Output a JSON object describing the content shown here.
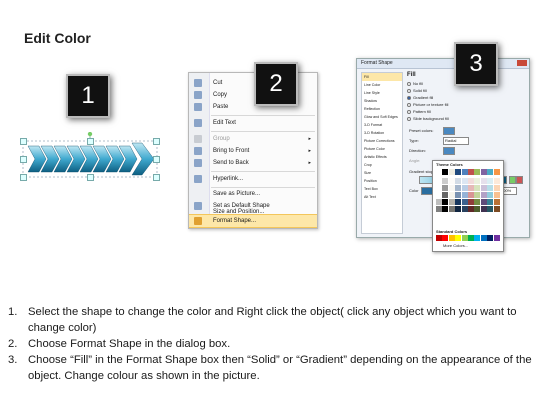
{
  "title": "Edit Color",
  "badges": [
    "1",
    "2",
    "3"
  ],
  "menu": {
    "items": [
      {
        "label": "Cut",
        "arrow": ""
      },
      {
        "label": "Copy",
        "arrow": ""
      },
      {
        "label": "Paste",
        "arrow": ""
      },
      {
        "label": "Edit Text",
        "arrow": ""
      },
      {
        "label": "Group",
        "arrow": "▸"
      },
      {
        "label": "Bring to Front",
        "arrow": "▸"
      },
      {
        "label": "Send to Back",
        "arrow": "▸"
      },
      {
        "label": "Hyperlink...",
        "arrow": ""
      },
      {
        "label": "Save as Picture...",
        "arrow": ""
      },
      {
        "label": "Set as Default Shape",
        "arrow": ""
      },
      {
        "label": "Size and Position...",
        "arrow": ""
      },
      {
        "label": "Format Shape...",
        "arrow": ""
      }
    ]
  },
  "dialog": {
    "title": "Format Shape",
    "nav": [
      "Fill",
      "Line Color",
      "Line Style",
      "Shadow",
      "Reflection",
      "Glow and Soft Edges",
      "3-D Format",
      "3-D Rotation",
      "Picture Corrections",
      "Picture Color",
      "Artistic Effects",
      "Crop",
      "Size",
      "Position",
      "Text Box",
      "Alt Text"
    ],
    "section": "Fill",
    "options": [
      "No fill",
      "Solid fill",
      "Gradient fill",
      "Picture or texture fill",
      "Pattern fill",
      "Slide background fill"
    ],
    "labels": {
      "preset": "Preset colors:",
      "type": "Type:",
      "type_value": "Radial",
      "direction": "Direction:",
      "angle": "Angle:",
      "stops": "Gradient stops",
      "color": "Color",
      "position": "Position:",
      "position_value": "100%",
      "brightness": "Brightness:",
      "transparency": "Transparency:",
      "rotate": "Rotate with shape"
    }
  },
  "palette": {
    "theme_label": "Theme Colors",
    "standard_label": "Standard Colors",
    "more_label": "More Colors...",
    "theme_top": [
      "#ffffff",
      "#000000",
      "#eeece1",
      "#1f497d",
      "#4f81bd",
      "#c0504d",
      "#9bbb59",
      "#8064a2",
      "#4bacc6",
      "#f79646"
    ],
    "standard": [
      "#c00000",
      "#ff0000",
      "#ffc000",
      "#ffff00",
      "#92d050",
      "#00b050",
      "#00b0f0",
      "#0070c0",
      "#002060",
      "#7030a0"
    ]
  },
  "steps": [
    {
      "num": "1.",
      "text": "Select the shape to change the color and Right click the object( click any object which you want to change color)"
    },
    {
      "num": "2.",
      "text": "Choose Format Shape in the dialog box."
    },
    {
      "num": "3.",
      "text": "Choose “Fill” in the Format Shape box then “Solid” or “Gradient” depending on the appearance of the object. Change colour as shown in the picture."
    }
  ],
  "colors": {
    "arrow_light": "#cfeef7",
    "arrow_mid": "#3fa9cf",
    "arrow_dark": "#0e5f82",
    "menu_highlight": "#fde7a8"
  }
}
